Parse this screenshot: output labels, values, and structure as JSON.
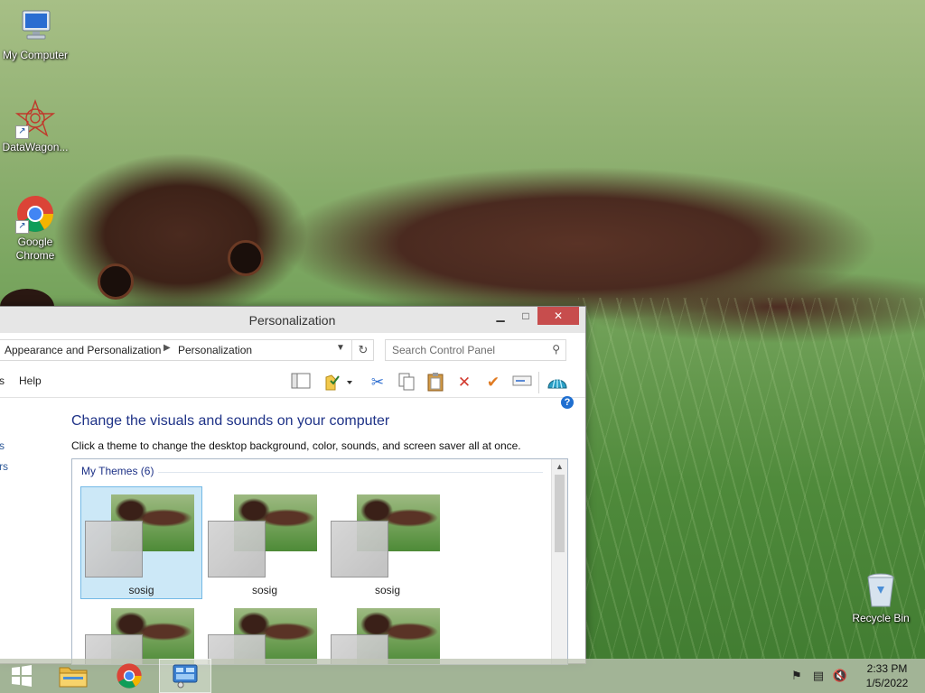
{
  "desktop": {
    "icons": [
      {
        "label": "My Computer",
        "icon": "computer-icon"
      },
      {
        "label": "DataWagon...",
        "icon": "datawagon-icon"
      },
      {
        "label": "Google Chrome",
        "icon": "chrome-icon"
      },
      {
        "label": "Recycle Bin",
        "icon": "recycle-bin-icon"
      }
    ]
  },
  "window": {
    "title": "Personalization",
    "controls": {
      "minimize": "minimize-icon",
      "maximize": "maximize-icon",
      "close": "close-icon"
    },
    "breadcrumb": [
      "Appearance and Personalization",
      "Personalization"
    ],
    "search": {
      "placeholder": "Search Control Panel"
    },
    "menu": {
      "partial": "s",
      "help": "Help"
    },
    "toolbar_icons": [
      "view-pane-icon",
      "properties-icon",
      "cut-icon",
      "copy-icon",
      "paste-icon",
      "delete-icon",
      "check-icon",
      "rename-icon",
      "shell-icon"
    ],
    "left_pane": [
      "s",
      "rs"
    ],
    "heading": "Change the visuals and sounds on your computer",
    "description": "Click a theme to change the desktop background, color, sounds, and screen saver all at once.",
    "group_header": "My Themes (6)",
    "themes": [
      {
        "name": "sosig",
        "selected": true
      },
      {
        "name": "sosig",
        "selected": false
      },
      {
        "name": "sosig",
        "selected": false
      },
      {
        "name": "",
        "selected": false
      },
      {
        "name": "",
        "selected": false
      },
      {
        "name": "",
        "selected": false
      }
    ]
  },
  "taskbar": {
    "buttons": [
      "windows-start-icon",
      "file-explorer-icon",
      "chrome-icon",
      "control-panel-icon"
    ],
    "tray": [
      "action-center-flag-icon",
      "network-icon",
      "volume-muted-icon"
    ],
    "time": "2:33 PM",
    "date": "1/5/2022"
  },
  "colors": {
    "close_button": "#c74d4d",
    "heading": "#1e3287",
    "selection": "#cce8f7"
  }
}
